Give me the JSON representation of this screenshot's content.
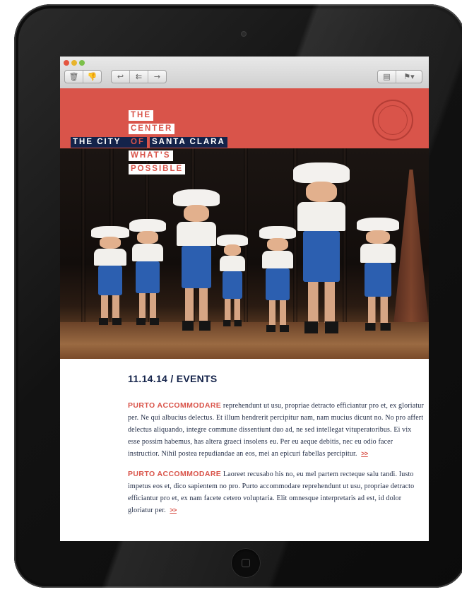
{
  "device": {
    "camera_icon": "camera-dot",
    "home_icon": "home-button"
  },
  "mail": {
    "toolbar": {
      "left_buttons": [
        {
          "icon": "trash-icon",
          "glyph": "🗑"
        },
        {
          "icon": "junk-icon",
          "glyph": "👎"
        },
        {
          "icon": "reply-icon",
          "glyph": "↩"
        },
        {
          "icon": "reply-all-icon",
          "glyph": "⇇"
        },
        {
          "icon": "forward-icon",
          "glyph": "→"
        }
      ],
      "right_buttons": [
        {
          "icon": "print-icon",
          "glyph": "▤"
        },
        {
          "icon": "flag-icon",
          "glyph": "⚑▾"
        }
      ]
    }
  },
  "header": {
    "background": "#d9544a",
    "seal_text": "THE CITY OF SANTA CLARA CALIFORNIA"
  },
  "lockup": {
    "line1": "THE",
    "line2": "CENTER",
    "line3_a": "THE CITY",
    "line3_b": "OF",
    "line3_c": "SANTA CLARA",
    "line4": "WHAT’S",
    "line5": "POSSIBLE"
  },
  "colors": {
    "accent_red": "#d9544a",
    "navy": "#14234a"
  },
  "article": {
    "heading": "11.14.14 / EVENTS",
    "paragraphs": [
      {
        "lead": "PURTO ACCOMMODARE",
        "body": "reprehendunt ut usu, propriae detracto efficiantur pro et, ex gloriatur per. Ne qui albucius delectus. Et illum hendrerit percipitur nam, nam mucius dicunt no. No pro affert delectus aliquando, integre commune dissentiunt duo ad, ne sed intellegat vituperatoribus. Ei vix esse possim habemus, has altera graeci insolens eu. Per eu aeque debitis, nec eu odio facer instructior. Nihil postea repudiandae an eos, mei an epicuri fabellas percipitur.",
        "more": ">>"
      },
      {
        "lead": "PURTO ACCOMMODARE",
        "body": "Laoreet recusabo his no, eu mel partem recteque salu tandi. Iusto impetus eos et, dico sapientem no pro. Purto accommodare reprehendunt ut usu, propriae detracto efficiantur pro et, ex nam facete cetero voluptaria. Elit omnesque interpretaris ad est, id dolor gloriatur per.",
        "more": ">>"
      }
    ]
  }
}
